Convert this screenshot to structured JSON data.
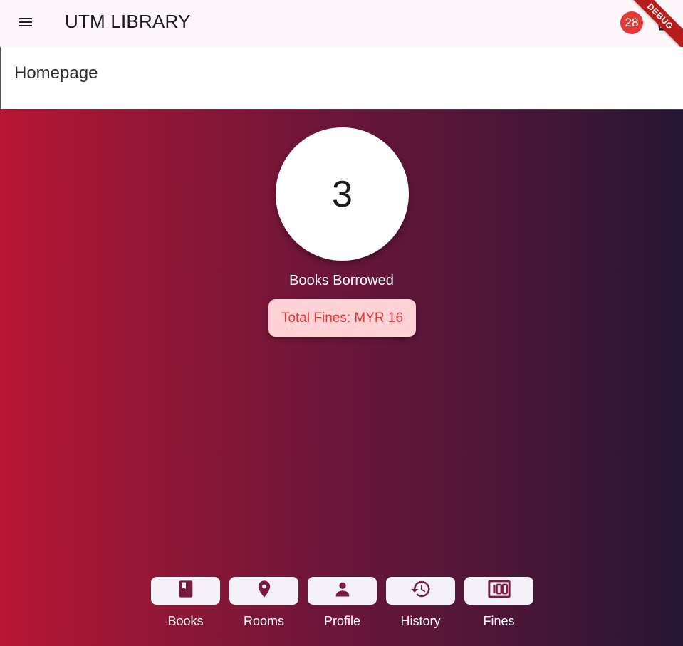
{
  "app": {
    "title": "UTM LIBRARY",
    "cart_count": "28",
    "debug_banner": "DEBUG"
  },
  "page": {
    "title": "Homepage"
  },
  "summary": {
    "books_borrowed_count": "3",
    "books_borrowed_label": "Books Borrowed",
    "total_fines": "Total Fines: MYR 16"
  },
  "nav": {
    "items": [
      {
        "label": "Books",
        "icon": "book-icon"
      },
      {
        "label": "Rooms",
        "icon": "location-pin-icon"
      },
      {
        "label": "Profile",
        "icon": "person-icon"
      },
      {
        "label": "History",
        "icon": "history-icon"
      },
      {
        "label": "Fines",
        "icon": "money-icon"
      }
    ]
  },
  "colors": {
    "icon": "#7b1a3f",
    "gradient_start": "#b81634",
    "gradient_end": "#251633",
    "fines_bg": "#ffd3d6",
    "fines_text": "#e53935",
    "badge": "#e53935"
  }
}
